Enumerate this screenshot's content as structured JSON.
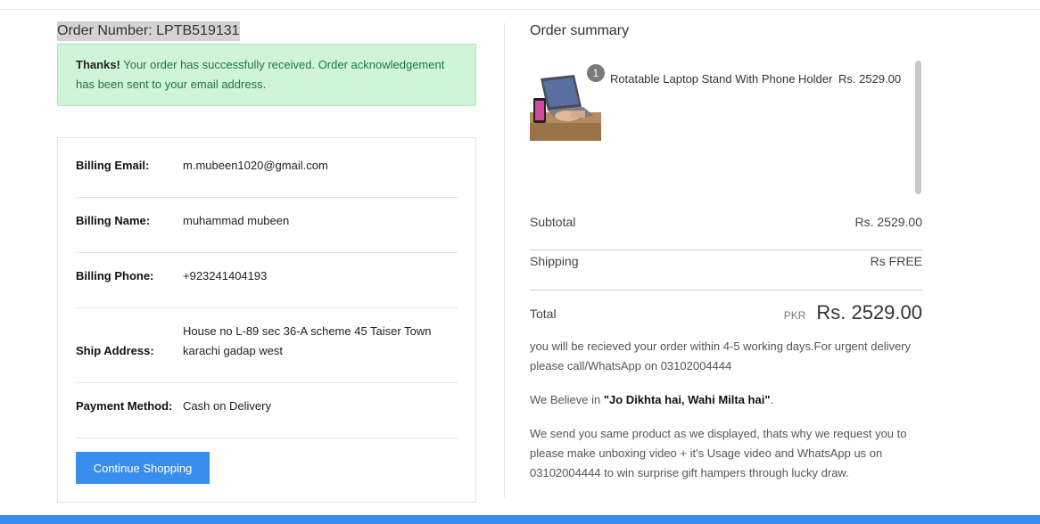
{
  "order": {
    "number_label": "Order Number: LPTB519131"
  },
  "alert": {
    "strong": "Thanks!",
    "message": "Your order has successfully received. Order acknowledgement has been sent to your email address."
  },
  "billing": {
    "rows": [
      {
        "label": "Billing Email:",
        "value": "m.mubeen1020@gmail.com"
      },
      {
        "label": "Billing Name:",
        "value": "muhammad mubeen"
      },
      {
        "label": "Billing Phone:",
        "value": "+923241404193"
      },
      {
        "label": "Ship Address:",
        "value": "House no L-89 sec 36-A scheme 45 Taiser Town karachi gadap west"
      },
      {
        "label": "Payment Method:",
        "value": "Cash on Delivery"
      }
    ],
    "continue_label": "Continue Shopping"
  },
  "summary": {
    "title": "Order summary",
    "item": {
      "name": "Rotatable Laptop Stand With Phone Holder",
      "price": "Rs. 2529.00",
      "quantity": "1",
      "image_icon": "laptop-stand-product-image"
    },
    "subtotal_label": "Subtotal",
    "subtotal_value": "Rs. 2529.00",
    "shipping_label": "Shipping",
    "shipping_value": "Rs FREE",
    "total_label": "Total",
    "total_currency": "PKR",
    "total_value": "Rs. 2529.00"
  },
  "notes": {
    "delivery": "you will be recieved your order within 4-5 working days.For urgent delivery please call/WhatsApp on 03102004444",
    "believe_prefix": "We Believe in ",
    "believe_quote": "\"Jo Dikhta hai, Wahi Milta hai\"",
    "believe_suffix": ".",
    "unboxing": "We send you same product as we displayed, thats why we request you to please make unboxing video + it's Usage video and WhatsApp us on 03102004444 to win surprise gift hampers through lucky draw."
  },
  "colors": {
    "primary": "#3b8ded",
    "alert_bg": "#cff4d8",
    "alert_text": "#1d7a3a"
  }
}
